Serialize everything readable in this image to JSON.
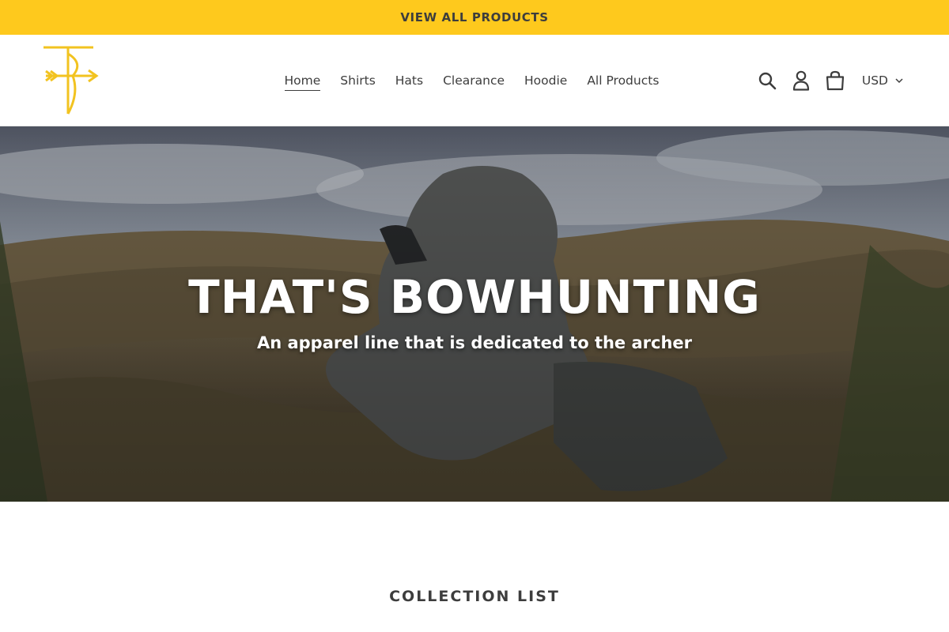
{
  "announcement": {
    "text": "VIEW ALL PRODUCTS"
  },
  "header": {
    "logo": "TB bow-and-arrow logo",
    "nav": [
      {
        "label": "Home",
        "active": true
      },
      {
        "label": "Shirts",
        "active": false
      },
      {
        "label": "Hats",
        "active": false
      },
      {
        "label": "Clearance",
        "active": false
      },
      {
        "label": "Hoodie",
        "active": false
      },
      {
        "label": "All Products",
        "active": false
      }
    ],
    "icons": [
      "search-icon",
      "account-icon",
      "cart-icon"
    ],
    "currency": "USD"
  },
  "hero": {
    "title": "THAT'S BOWHUNTING",
    "subtitle": "An apparel line that is dedicated to the archer"
  },
  "collection": {
    "heading": "COLLECTION LIST"
  },
  "colors": {
    "accent": "#fec91d",
    "text": "#3d3d3d",
    "logo": "#f2c320"
  }
}
